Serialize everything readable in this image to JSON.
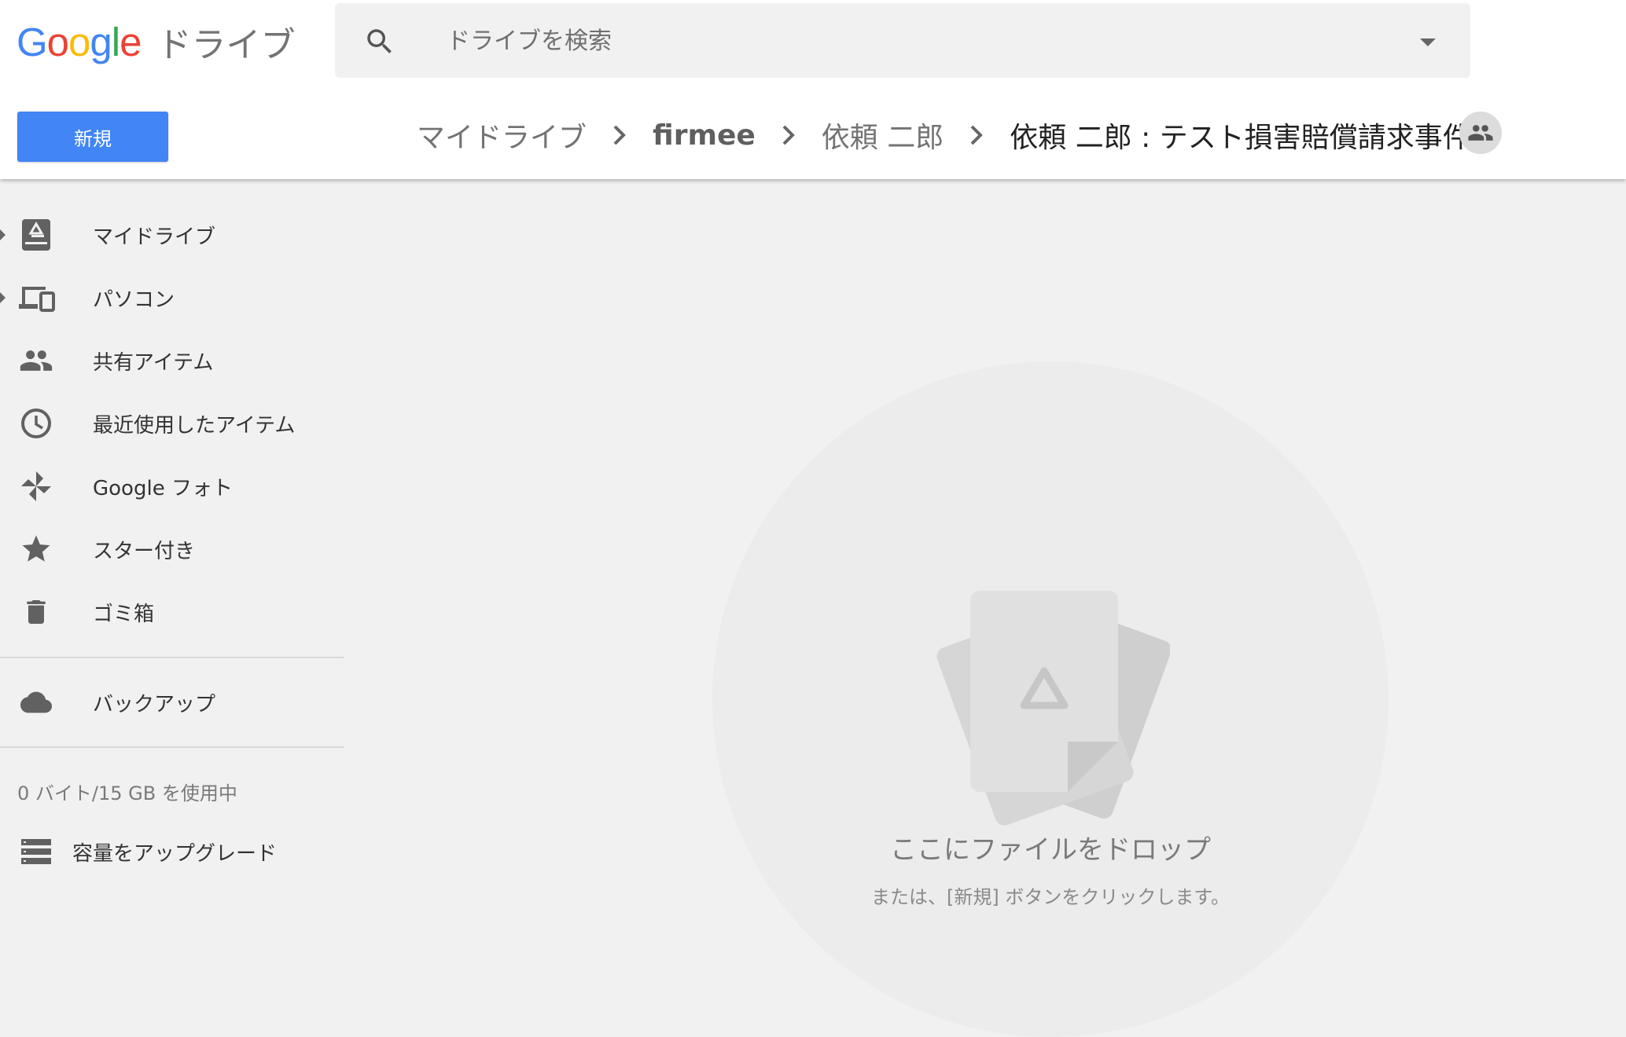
{
  "header": {
    "logo": {
      "google": "Google",
      "product": "ドライブ"
    },
    "search": {
      "placeholder": "ドライブを検索"
    },
    "new_button": "新規",
    "breadcrumb": [
      "マイドライブ",
      "firmee",
      "依頼 二郎",
      "依頼 二郎 : テスト損害賠償請求事件"
    ]
  },
  "sidebar": {
    "items": [
      {
        "label": "マイドライブ",
        "icon": "my-drive-icon"
      },
      {
        "label": "パソコン",
        "icon": "computers-icon"
      },
      {
        "label": "共有アイテム",
        "icon": "people-icon"
      },
      {
        "label": "最近使用したアイテム",
        "icon": "clock-icon"
      },
      {
        "label": "Google フォト",
        "icon": "pinwheel-icon"
      },
      {
        "label": "スター付き",
        "icon": "star-icon"
      },
      {
        "label": "ゴミ箱",
        "icon": "trash-icon"
      }
    ],
    "backup": {
      "label": "バックアップ",
      "icon": "cloud-icon"
    },
    "storage_text": "0 バイト/15 GB を使用中",
    "upgrade": {
      "label": "容量をアップグレード",
      "icon": "storage-icon"
    }
  },
  "main": {
    "drop_title": "ここにファイルをドロップ",
    "drop_subtitle": "または、[新規] ボタンをクリックします。"
  },
  "colors": {
    "accent": "#4285f4",
    "background": "#f1f1f1"
  }
}
